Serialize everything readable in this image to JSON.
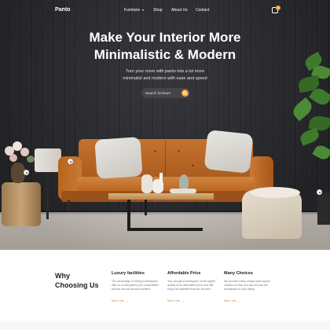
{
  "colors": {
    "accent": "#f2a33a",
    "link": "#e38a2c",
    "wall": "#2c2d31",
    "sofa": "#c4722e"
  },
  "nav": {
    "logo": "Panto",
    "links": [
      {
        "label": "Furniture",
        "has_dropdown": true
      },
      {
        "label": "Shop"
      },
      {
        "label": "About Us"
      },
      {
        "label": "Contact"
      }
    ],
    "cart_icon": "bag-icon",
    "cart_count": "0"
  },
  "hero": {
    "headline_line1": "Make Your Interior More",
    "headline_line2": "Minimalistic & Modern",
    "subtitle_line1": "Turn your room with panto into a lot more",
    "subtitle_line2": "minimalist and modern with ease and speed",
    "search": {
      "placeholder": "Search furniture",
      "icon": "search-icon"
    }
  },
  "why": {
    "title_line1": "Why",
    "title_line2": "Choosing Us",
    "features": [
      {
        "title": "Luxury facilities",
        "desc": "The advantage of hiring a workspace with us is that givees you comfortable service and all-around facilities.",
        "link": "More Info"
      },
      {
        "title": "Affordable Price",
        "desc": "You can get a workspace of the highst quality at an affordable price and still enjoy the facilities that are oly here.",
        "link": "More Info"
      },
      {
        "title": "Many Choices",
        "desc": "We provide many unique work space choices so that you can choose the workspace to your liking.",
        "link": "More Info"
      }
    ],
    "link_arrow": "→"
  }
}
